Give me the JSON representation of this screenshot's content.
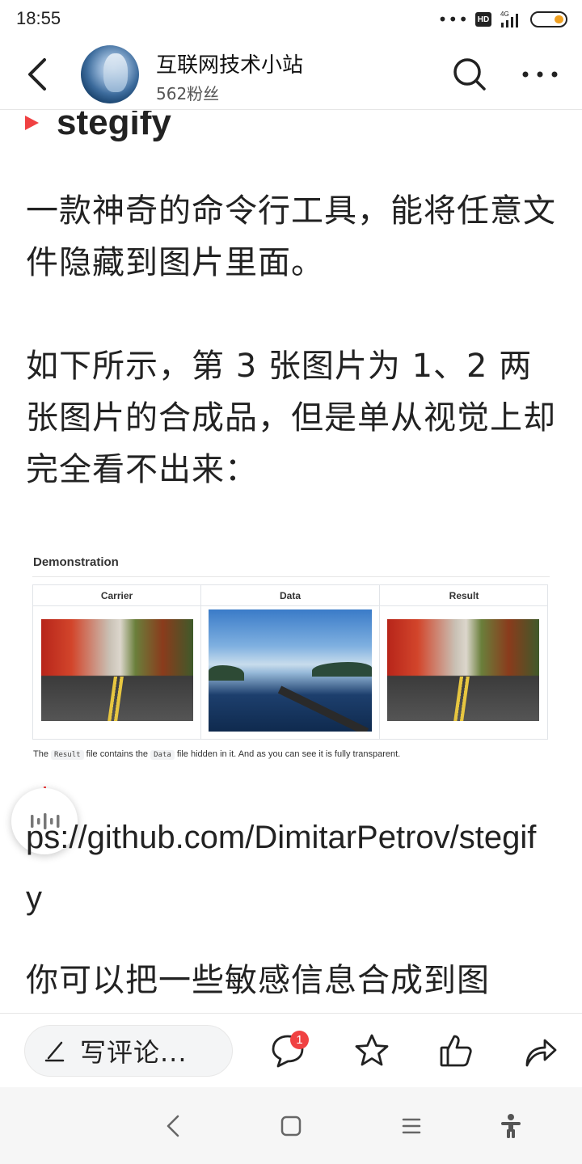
{
  "status_bar": {
    "time": "18:55",
    "signal_type": "4G",
    "hd_label": "HD",
    "battery_level": 0.3,
    "icons": [
      "dots-icon",
      "hd-icon",
      "signal-icon",
      "battery-icon"
    ]
  },
  "header": {
    "channel_name": "互联网技术小站",
    "fans": "562粉丝",
    "icons": [
      "back-icon",
      "avatar",
      "search-icon",
      "more-icon"
    ]
  },
  "article": {
    "heading": "stegify",
    "paragraph_1": "一款神奇的命令行工具，能将任意文件隐藏到图片里面。",
    "paragraph_2": "如下所示，第 3 张图片为 1、2 两张图片的合成品，但是单从视觉上却完全看不出来：",
    "demo": {
      "title": "Demonstration",
      "columns": [
        "Carrier",
        "Data",
        "Result"
      ],
      "caption_pre": "The",
      "caption_code_1": "Result",
      "caption_mid": "file contains the",
      "caption_code_2": "Data",
      "caption_post": "file hidden in it. And as you can see it is fully transparent."
    },
    "link_visible": "ps://github.com/DimitarPetrov/stegify",
    "paragraph_3": "你可以把一些敏感信息合成到图"
  },
  "bottom_bar": {
    "comment_placeholder": "写评论...",
    "comment_count": "1",
    "icons": [
      "pen-icon",
      "comment-icon",
      "star-icon",
      "thumbs-up-icon",
      "share-icon"
    ]
  },
  "nav_bar": {
    "icons": [
      "nav-back-icon",
      "home-icon",
      "menu-icon",
      "accessibility-icon"
    ]
  },
  "colors": {
    "accent": "#f04142",
    "text": "#222222",
    "divider": "#e6e6e6",
    "battery": "#f0a020"
  }
}
